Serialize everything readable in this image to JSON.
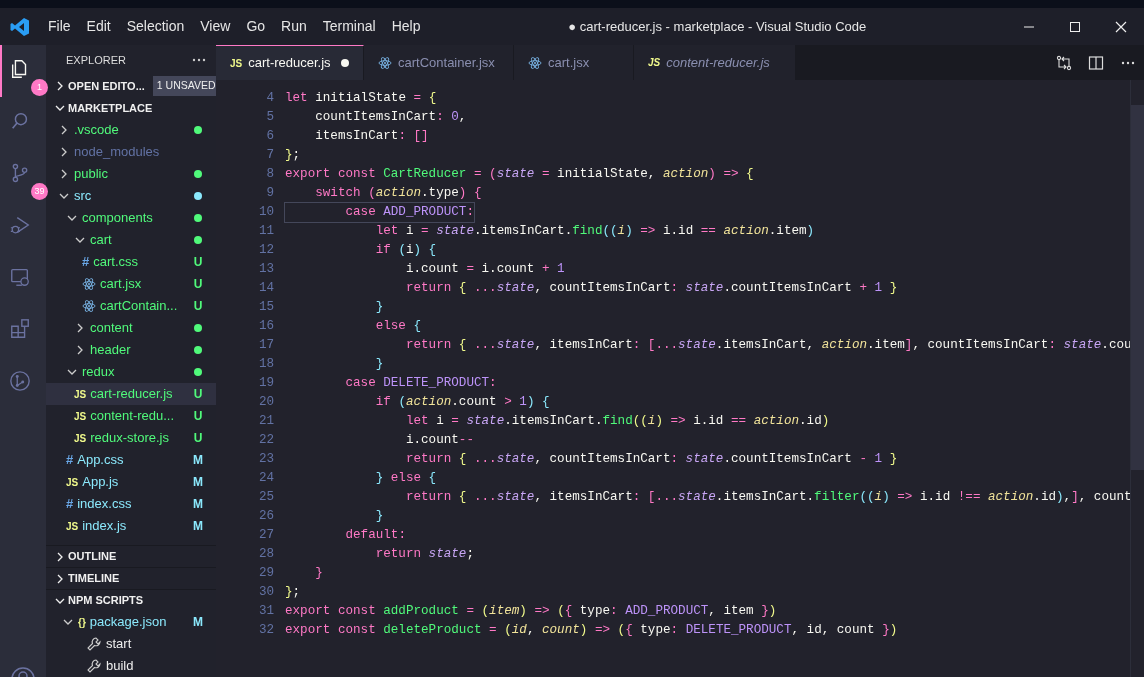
{
  "window": {
    "title": "● cart-reducer.js - marketplace - Visual Studio Code"
  },
  "menu": [
    "File",
    "Edit",
    "Selection",
    "View",
    "Go",
    "Run",
    "Terminal",
    "Help"
  ],
  "activity_bar": [
    {
      "kind": "files",
      "selected": true,
      "badge": "1"
    },
    {
      "kind": "search",
      "selected": false
    },
    {
      "kind": "source-control",
      "selected": false,
      "badge": "39"
    },
    {
      "kind": "run",
      "selected": false
    },
    {
      "kind": "remote",
      "selected": false
    },
    {
      "kind": "extensions",
      "selected": false
    },
    {
      "kind": "git-graph",
      "selected": false
    }
  ],
  "sidebar": {
    "title": "EXPLORER",
    "open_editors": {
      "label": "OPEN EDITO...",
      "expanded": false,
      "badge": "1 UNSAVED"
    },
    "folder": {
      "label": "MARKETPLACE",
      "expanded": true,
      "items": [
        {
          "name": ".vscode",
          "kind": "folder",
          "expanded": false,
          "color": "#50fa7b",
          "dot": true,
          "selected": false
        },
        {
          "name": "node_modules",
          "kind": "folder",
          "expanded": false,
          "color": "#6272a4",
          "dot": false,
          "selected": false
        },
        {
          "name": "public",
          "kind": "folder",
          "expanded": false,
          "color": "#50fa7b",
          "dot": true,
          "selected": false
        },
        {
          "name": "src",
          "kind": "folder",
          "expanded": true,
          "color": "#8be9fd",
          "dot": true,
          "selected": false,
          "children": [
            {
              "name": "components",
              "kind": "folder",
              "expanded": true,
              "color": "#50fa7b",
              "dot": true,
              "selected": false,
              "children": [
                {
                  "name": "cart",
                  "kind": "folder",
                  "expanded": true,
                  "color": "#50fa7b",
                  "dot": true,
                  "selected": false,
                  "children": [
                    {
                      "name": "cart.css",
                      "kind": "css",
                      "icon": "#",
                      "color": "#50fa7b",
                      "status": "U",
                      "selected": false
                    },
                    {
                      "name": "cart.jsx",
                      "kind": "react",
                      "color": "#50fa7b",
                      "status": "U",
                      "selected": false
                    },
                    {
                      "name": "cartContain...",
                      "kind": "react",
                      "color": "#50fa7b",
                      "status": "U",
                      "selected": false
                    }
                  ]
                },
                {
                  "name": "content",
                  "kind": "folder",
                  "expanded": false,
                  "color": "#50fa7b",
                  "dot": true,
                  "selected": false
                },
                {
                  "name": "header",
                  "kind": "folder",
                  "expanded": false,
                  "color": "#50fa7b",
                  "dot": true,
                  "selected": false
                }
              ]
            },
            {
              "name": "redux",
              "kind": "folder",
              "expanded": true,
              "color": "#50fa7b",
              "dot": true,
              "selected": false,
              "children": [
                {
                  "name": "cart-reducer.js",
                  "kind": "js",
                  "icon": "JS",
                  "color": "#50fa7b",
                  "status": "U",
                  "selected": true
                },
                {
                  "name": "content-redu...",
                  "kind": "js",
                  "icon": "JS",
                  "color": "#50fa7b",
                  "status": "U",
                  "selected": false
                },
                {
                  "name": "redux-store.js",
                  "kind": "js",
                  "icon": "JS",
                  "color": "#50fa7b",
                  "status": "U",
                  "selected": false
                }
              ]
            },
            {
              "name": "App.css",
              "kind": "css",
              "icon": "#",
              "color": "#8be9fd",
              "status": "M",
              "selected": false
            },
            {
              "name": "App.js",
              "kind": "js",
              "icon": "JS",
              "color": "#8be9fd",
              "status": "M",
              "selected": false
            },
            {
              "name": "index.css",
              "kind": "css",
              "icon": "#",
              "color": "#8be9fd",
              "status": "M",
              "selected": false
            },
            {
              "name": "index.js",
              "kind": "js",
              "icon": "JS",
              "color": "#8be9fd",
              "status": "M",
              "selected": false
            }
          ]
        }
      ]
    },
    "sections": [
      {
        "label": "OUTLINE",
        "expanded": false
      },
      {
        "label": "TIMELINE",
        "expanded": false
      },
      {
        "label": "NPM SCRIPTS",
        "expanded": true,
        "package": {
          "icon": "{}",
          "name": "package.json",
          "status": "M",
          "expanded": true,
          "scripts": [
            "start",
            "build"
          ]
        }
      }
    ]
  },
  "tabs": [
    {
      "label": "cart-reducer.js",
      "kind": "js",
      "icon": "JS",
      "selected": true,
      "dirty": true,
      "preview": false
    },
    {
      "label": "cartContainer.jsx",
      "kind": "react",
      "selected": false,
      "dirty": false,
      "preview": false
    },
    {
      "label": "cart.jsx",
      "kind": "react",
      "selected": false,
      "dirty": false,
      "preview": false
    },
    {
      "label": "content-reducer.js",
      "kind": "js",
      "icon": "JS",
      "selected": false,
      "dirty": false,
      "preview": true
    }
  ],
  "editor": {
    "lines": [
      {
        "number": "4",
        "current": false,
        "segments": [
          {
            "kind": "kw",
            "text": "let"
          },
          {
            "kind": "id",
            "text": " initialState "
          },
          {
            "kind": "op",
            "text": "= "
          },
          {
            "kind": "b1",
            "text": "{"
          }
        ]
      },
      {
        "number": "5",
        "current": false,
        "segments": [
          {
            "kind": "id",
            "text": "    countItemsInCart"
          },
          {
            "kind": "op",
            "text": ": "
          },
          {
            "kind": "num",
            "text": "0"
          },
          {
            "kind": "id",
            "text": ","
          }
        ]
      },
      {
        "number": "6",
        "current": false,
        "segments": [
          {
            "kind": "id",
            "text": "    itemsInCart"
          },
          {
            "kind": "op",
            "text": ": "
          },
          {
            "kind": "b2",
            "text": "[]"
          }
        ]
      },
      {
        "number": "7",
        "current": false,
        "segments": [
          {
            "kind": "b1",
            "text": "}"
          },
          {
            "kind": "id",
            "text": ";"
          }
        ]
      },
      {
        "number": "8",
        "current": false,
        "segments": [
          {
            "kind": "kw",
            "text": "export const "
          },
          {
            "kind": "fn",
            "text": "CartReducer "
          },
          {
            "kind": "op",
            "text": "= "
          },
          {
            "kind": "b2",
            "text": "("
          },
          {
            "kind": "var",
            "text": "state "
          },
          {
            "kind": "op",
            "text": "="
          },
          {
            "kind": "id",
            "text": " initialState, "
          },
          {
            "kind": "par",
            "text": "action"
          },
          {
            "kind": "b2",
            "text": ") "
          },
          {
            "kind": "op",
            "text": "=> "
          },
          {
            "kind": "b1",
            "text": "{"
          }
        ]
      },
      {
        "number": "9",
        "current": false,
        "segments": [
          {
            "kind": "kw",
            "text": "    switch "
          },
          {
            "kind": "b2",
            "text": "("
          },
          {
            "kind": "par",
            "text": "action"
          },
          {
            "kind": "id",
            "text": ".type"
          },
          {
            "kind": "b2",
            "text": ") {"
          }
        ]
      },
      {
        "number": "10",
        "current": true,
        "segments": [
          {
            "kind": "kw",
            "text": "        case "
          },
          {
            "kind": "const",
            "text": "ADD_PRODUCT"
          },
          {
            "kind": "op",
            "text": ":"
          }
        ]
      },
      {
        "number": "11",
        "current": false,
        "segments": [
          {
            "kind": "kw",
            "text": "            let"
          },
          {
            "kind": "id",
            "text": " i "
          },
          {
            "kind": "op",
            "text": "= "
          },
          {
            "kind": "var",
            "text": "state"
          },
          {
            "kind": "id",
            "text": ".itemsInCart."
          },
          {
            "kind": "fn",
            "text": "find"
          },
          {
            "kind": "b3",
            "text": "(("
          },
          {
            "kind": "par",
            "text": "i"
          },
          {
            "kind": "b3",
            "text": ") "
          },
          {
            "kind": "op",
            "text": "=>"
          },
          {
            "kind": "id",
            "text": " i.id "
          },
          {
            "kind": "op",
            "text": "== "
          },
          {
            "kind": "par",
            "text": "action"
          },
          {
            "kind": "id",
            "text": ".item"
          },
          {
            "kind": "b3",
            "text": ")"
          }
        ]
      },
      {
        "number": "12",
        "current": false,
        "segments": [
          {
            "kind": "kw",
            "text": "            if "
          },
          {
            "kind": "b3",
            "text": "("
          },
          {
            "kind": "id",
            "text": "i"
          },
          {
            "kind": "b3",
            "text": ") {"
          }
        ]
      },
      {
        "number": "13",
        "current": false,
        "segments": [
          {
            "kind": "id",
            "text": "                i.count "
          },
          {
            "kind": "op",
            "text": "="
          },
          {
            "kind": "id",
            "text": " i.count "
          },
          {
            "kind": "op",
            "text": "+ "
          },
          {
            "kind": "num",
            "text": "1"
          }
        ]
      },
      {
        "number": "14",
        "current": false,
        "segments": [
          {
            "kind": "kw",
            "text": "                return "
          },
          {
            "kind": "b1",
            "text": "{ "
          },
          {
            "kind": "op",
            "text": "..."
          },
          {
            "kind": "var",
            "text": "state"
          },
          {
            "kind": "id",
            "text": ", countItemsInCart"
          },
          {
            "kind": "op",
            "text": ": "
          },
          {
            "kind": "var",
            "text": "state"
          },
          {
            "kind": "id",
            "text": ".countItemsInCart "
          },
          {
            "kind": "op",
            "text": "+ "
          },
          {
            "kind": "num",
            "text": "1 "
          },
          {
            "kind": "b1",
            "text": "}"
          }
        ]
      },
      {
        "number": "15",
        "current": false,
        "segments": [
          {
            "kind": "b3",
            "text": "            }"
          }
        ]
      },
      {
        "number": "16",
        "current": false,
        "segments": [
          {
            "kind": "kw",
            "text": "            else "
          },
          {
            "kind": "b3",
            "text": "{"
          }
        ]
      },
      {
        "number": "17",
        "current": false,
        "segments": [
          {
            "kind": "kw",
            "text": "                return "
          },
          {
            "kind": "b1",
            "text": "{ "
          },
          {
            "kind": "op",
            "text": "..."
          },
          {
            "kind": "var",
            "text": "state"
          },
          {
            "kind": "id",
            "text": ", itemsInCart"
          },
          {
            "kind": "op",
            "text": ": "
          },
          {
            "kind": "b2",
            "text": "["
          },
          {
            "kind": "op",
            "text": "..."
          },
          {
            "kind": "var",
            "text": "state"
          },
          {
            "kind": "id",
            "text": ".itemsInCart, "
          },
          {
            "kind": "par",
            "text": "action"
          },
          {
            "kind": "id",
            "text": ".item"
          },
          {
            "kind": "b2",
            "text": "]"
          },
          {
            "kind": "id",
            "text": ", countItemsInCart"
          },
          {
            "kind": "op",
            "text": ": "
          },
          {
            "kind": "var",
            "text": "state"
          },
          {
            "kind": "id",
            "text": ".cou"
          }
        ]
      },
      {
        "number": "18",
        "current": false,
        "segments": [
          {
            "kind": "b3",
            "text": "            }"
          }
        ]
      },
      {
        "number": "19",
        "current": false,
        "segments": [
          {
            "kind": "kw",
            "text": "        case "
          },
          {
            "kind": "const",
            "text": "DELETE_PRODUCT"
          },
          {
            "kind": "op",
            "text": ":"
          }
        ]
      },
      {
        "number": "20",
        "current": false,
        "segments": [
          {
            "kind": "kw",
            "text": "            if "
          },
          {
            "kind": "b3",
            "text": "("
          },
          {
            "kind": "par",
            "text": "action"
          },
          {
            "kind": "id",
            "text": ".count "
          },
          {
            "kind": "op",
            "text": "> "
          },
          {
            "kind": "num",
            "text": "1"
          },
          {
            "kind": "b3",
            "text": ") {"
          }
        ]
      },
      {
        "number": "21",
        "current": false,
        "segments": [
          {
            "kind": "kw",
            "text": "                let"
          },
          {
            "kind": "id",
            "text": " i "
          },
          {
            "kind": "op",
            "text": "= "
          },
          {
            "kind": "var",
            "text": "state"
          },
          {
            "kind": "id",
            "text": ".itemsInCart."
          },
          {
            "kind": "fn",
            "text": "find"
          },
          {
            "kind": "b1",
            "text": "(("
          },
          {
            "kind": "par",
            "text": "i"
          },
          {
            "kind": "b1",
            "text": ") "
          },
          {
            "kind": "op",
            "text": "=>"
          },
          {
            "kind": "id",
            "text": " i.id "
          },
          {
            "kind": "op",
            "text": "== "
          },
          {
            "kind": "par",
            "text": "action"
          },
          {
            "kind": "id",
            "text": ".id"
          },
          {
            "kind": "b1",
            "text": ")"
          }
        ]
      },
      {
        "number": "22",
        "current": false,
        "segments": [
          {
            "kind": "id",
            "text": "                i.count"
          },
          {
            "kind": "op",
            "text": "--"
          }
        ]
      },
      {
        "number": "23",
        "current": false,
        "segments": [
          {
            "kind": "kw",
            "text": "                return "
          },
          {
            "kind": "b1",
            "text": "{ "
          },
          {
            "kind": "op",
            "text": "..."
          },
          {
            "kind": "var",
            "text": "state"
          },
          {
            "kind": "id",
            "text": ", countItemsInCart"
          },
          {
            "kind": "op",
            "text": ": "
          },
          {
            "kind": "var",
            "text": "state"
          },
          {
            "kind": "id",
            "text": ".countItemsInCart "
          },
          {
            "kind": "op",
            "text": "- "
          },
          {
            "kind": "num",
            "text": "1 "
          },
          {
            "kind": "b1",
            "text": "}"
          }
        ]
      },
      {
        "number": "24",
        "current": false,
        "segments": [
          {
            "kind": "b3",
            "text": "            } "
          },
          {
            "kind": "kw",
            "text": "else "
          },
          {
            "kind": "b3",
            "text": "{"
          }
        ]
      },
      {
        "number": "25",
        "current": false,
        "segments": [
          {
            "kind": "kw",
            "text": "                return "
          },
          {
            "kind": "b1",
            "text": "{ "
          },
          {
            "kind": "op",
            "text": "..."
          },
          {
            "kind": "var",
            "text": "state"
          },
          {
            "kind": "id",
            "text": ", itemsInCart"
          },
          {
            "kind": "op",
            "text": ": "
          },
          {
            "kind": "b2",
            "text": "["
          },
          {
            "kind": "op",
            "text": "..."
          },
          {
            "kind": "var",
            "text": "state"
          },
          {
            "kind": "id",
            "text": ".itemsInCart."
          },
          {
            "kind": "fn",
            "text": "filter"
          },
          {
            "kind": "b3",
            "text": "(("
          },
          {
            "kind": "par",
            "text": "i"
          },
          {
            "kind": "b3",
            "text": ") "
          },
          {
            "kind": "op",
            "text": "=>"
          },
          {
            "kind": "id",
            "text": " i.id "
          },
          {
            "kind": "op",
            "text": "!== "
          },
          {
            "kind": "par",
            "text": "action"
          },
          {
            "kind": "id",
            "text": ".id"
          },
          {
            "kind": "b3",
            "text": ")"
          },
          {
            "kind": "id",
            "text": ","
          },
          {
            "kind": "b2",
            "text": "]"
          },
          {
            "kind": "id",
            "text": ", count"
          }
        ]
      },
      {
        "number": "26",
        "current": false,
        "segments": [
          {
            "kind": "b3",
            "text": "            }"
          }
        ]
      },
      {
        "number": "27",
        "current": false,
        "segments": [
          {
            "kind": "kw",
            "text": "        default"
          },
          {
            "kind": "op",
            "text": ":"
          }
        ]
      },
      {
        "number": "28",
        "current": false,
        "segments": [
          {
            "kind": "kw",
            "text": "            return "
          },
          {
            "kind": "var",
            "text": "state"
          },
          {
            "kind": "id",
            "text": ";"
          }
        ]
      },
      {
        "number": "29",
        "current": false,
        "segments": [
          {
            "kind": "b2",
            "text": "    }"
          }
        ]
      },
      {
        "number": "30",
        "current": false,
        "segments": [
          {
            "kind": "b1",
            "text": "}"
          },
          {
            "kind": "id",
            "text": ";"
          }
        ]
      },
      {
        "number": "31",
        "current": false,
        "segments": [
          {
            "kind": "kw",
            "text": "export const "
          },
          {
            "kind": "fn",
            "text": "addProduct "
          },
          {
            "kind": "op",
            "text": "= "
          },
          {
            "kind": "b1",
            "text": "("
          },
          {
            "kind": "par",
            "text": "item"
          },
          {
            "kind": "b1",
            "text": ") "
          },
          {
            "kind": "op",
            "text": "=> "
          },
          {
            "kind": "b1",
            "text": "("
          },
          {
            "kind": "b2",
            "text": "{"
          },
          {
            "kind": "id",
            "text": " type"
          },
          {
            "kind": "op",
            "text": ": "
          },
          {
            "kind": "const",
            "text": "ADD_PRODUCT"
          },
          {
            "kind": "id",
            "text": ", item "
          },
          {
            "kind": "b2",
            "text": "}"
          },
          {
            "kind": "b1",
            "text": ")"
          }
        ]
      },
      {
        "number": "32",
        "current": false,
        "segments": [
          {
            "kind": "kw",
            "text": "export const "
          },
          {
            "kind": "fn",
            "text": "deleteProduct "
          },
          {
            "kind": "op",
            "text": "= "
          },
          {
            "kind": "b1",
            "text": "("
          },
          {
            "kind": "par",
            "text": "id"
          },
          {
            "kind": "id",
            "text": ", "
          },
          {
            "kind": "par",
            "text": "count"
          },
          {
            "kind": "b1",
            "text": ") "
          },
          {
            "kind": "op",
            "text": "=> "
          },
          {
            "kind": "b1",
            "text": "("
          },
          {
            "kind": "b2",
            "text": "{"
          },
          {
            "kind": "id",
            "text": " type"
          },
          {
            "kind": "op",
            "text": ": "
          },
          {
            "kind": "const",
            "text": "DELETE_PRODUCT"
          },
          {
            "kind": "id",
            "text": ", id, count "
          },
          {
            "kind": "b2",
            "text": "}"
          },
          {
            "kind": "b1",
            "text": ")"
          }
        ]
      }
    ]
  }
}
